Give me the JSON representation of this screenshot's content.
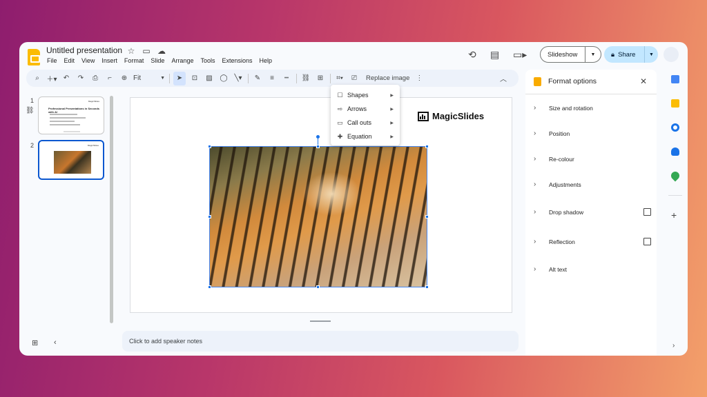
{
  "header": {
    "doc_title": "Untitled presentation",
    "menu": [
      "File",
      "Edit",
      "View",
      "Insert",
      "Format",
      "Slide",
      "Arrange",
      "Tools",
      "Extensions",
      "Help"
    ],
    "slideshow_label": "Slideshow",
    "share_label": "Share"
  },
  "toolbar": {
    "zoom": "Fit",
    "replace_image": "Replace image"
  },
  "crop_menu": {
    "items": [
      {
        "label": "Shapes",
        "icon": "square-icon"
      },
      {
        "label": "Arrows",
        "icon": "arrow-icon"
      },
      {
        "label": "Call outs",
        "icon": "callout-icon"
      },
      {
        "label": "Equation",
        "icon": "plus-cross-icon"
      }
    ]
  },
  "filmstrip": {
    "slides": [
      {
        "number": "1",
        "title": "Professional Presentations in Seconds with AI"
      },
      {
        "number": "2"
      }
    ]
  },
  "slide": {
    "brand": "MagicSlides"
  },
  "notes": {
    "placeholder": "Click to add speaker notes"
  },
  "format_panel": {
    "title": "Format options",
    "options": [
      {
        "label": "Size and rotation",
        "checkbox": false
      },
      {
        "label": "Position",
        "checkbox": false
      },
      {
        "label": "Re-colour",
        "checkbox": false
      },
      {
        "label": "Adjustments",
        "checkbox": false
      },
      {
        "label": "Drop shadow",
        "checkbox": true
      },
      {
        "label": "Reflection",
        "checkbox": true
      },
      {
        "label": "Alt text",
        "checkbox": false
      }
    ]
  },
  "colors": {
    "accent": "#0b57d0",
    "share_bg": "#c2e7ff",
    "slides_yellow": "#fbbc04"
  }
}
